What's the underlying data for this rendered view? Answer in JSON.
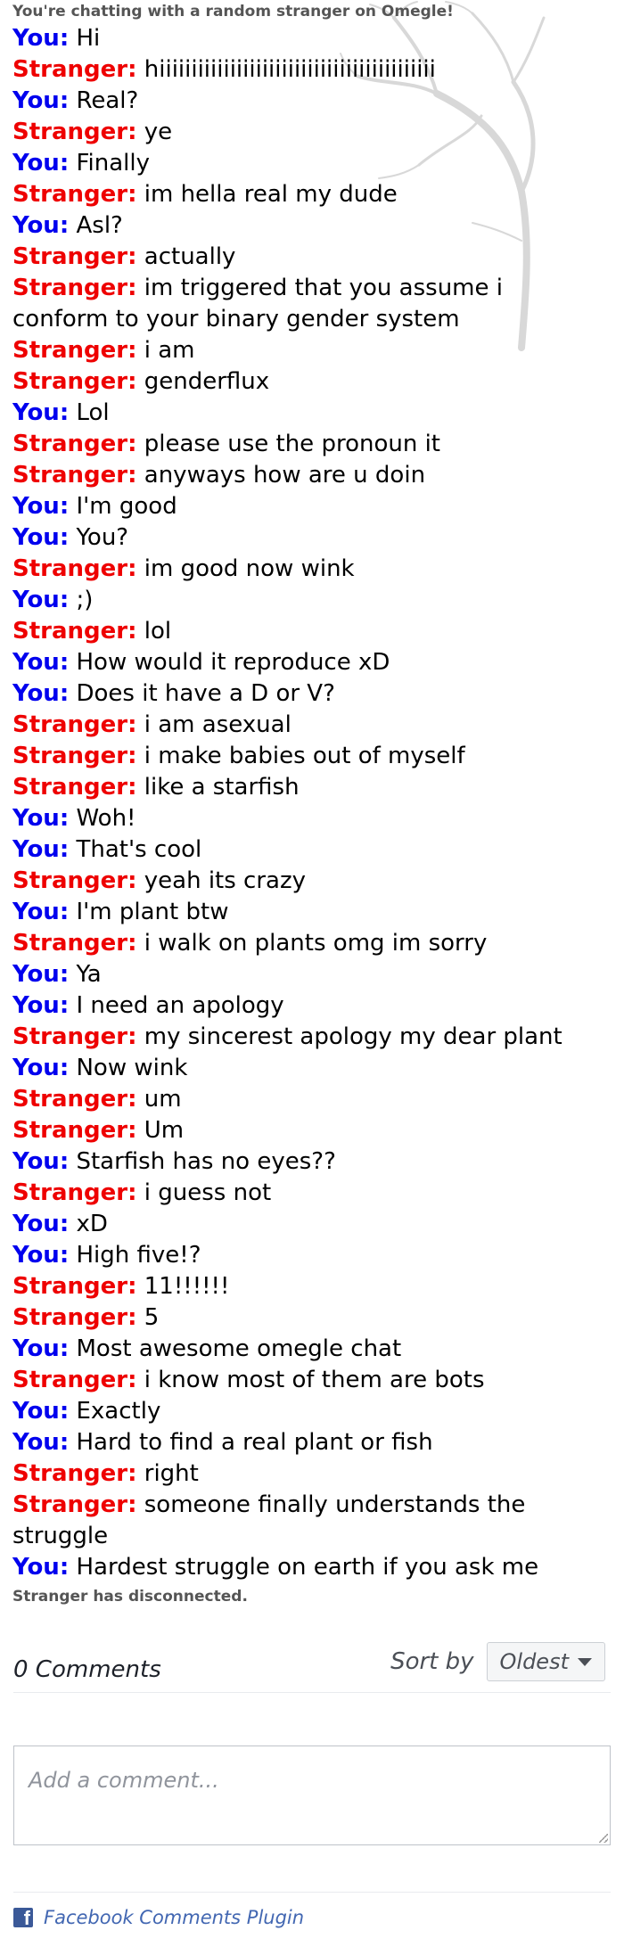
{
  "chat": {
    "header": "You're chatting with a random stranger on Omegle!",
    "messages": [
      {
        "sender": "You:",
        "text": "Hi",
        "role": "you"
      },
      {
        "sender": "Stranger:",
        "text": "hiiiiiiiiiiiiiiiiiiiiiiiiiiiiiiiiiiiiiiiiiii",
        "role": "stranger"
      },
      {
        "sender": "You:",
        "text": "Real?",
        "role": "you"
      },
      {
        "sender": "Stranger:",
        "text": "ye",
        "role": "stranger"
      },
      {
        "sender": "You:",
        "text": "Finally",
        "role": "you"
      },
      {
        "sender": "Stranger:",
        "text": "im hella real my dude",
        "role": "stranger"
      },
      {
        "sender": "You:",
        "text": "Asl?",
        "role": "you"
      },
      {
        "sender": "Stranger:",
        "text": "actually",
        "role": "stranger"
      },
      {
        "sender": "Stranger:",
        "text": "im triggered that you assume i conform to your binary gender system",
        "role": "stranger"
      },
      {
        "sender": "Stranger:",
        "text": "i am",
        "role": "stranger"
      },
      {
        "sender": "Stranger:",
        "text": "genderflux",
        "role": "stranger"
      },
      {
        "sender": "You:",
        "text": "Lol",
        "role": "you"
      },
      {
        "sender": "Stranger:",
        "text": "please use the pronoun it",
        "role": "stranger"
      },
      {
        "sender": "Stranger:",
        "text": "anyways how are u doin",
        "role": "stranger"
      },
      {
        "sender": "You:",
        "text": "I'm good",
        "role": "you"
      },
      {
        "sender": "You:",
        "text": "You?",
        "role": "you"
      },
      {
        "sender": "Stranger:",
        "text": "im good now wink",
        "role": "stranger"
      },
      {
        "sender": "You:",
        "text": ";)",
        "role": "you"
      },
      {
        "sender": "Stranger:",
        "text": "lol",
        "role": "stranger"
      },
      {
        "sender": "You:",
        "text": "How would it reproduce xD",
        "role": "you"
      },
      {
        "sender": "You:",
        "text": "Does it have a D or V?",
        "role": "you"
      },
      {
        "sender": "Stranger:",
        "text": "i am asexual",
        "role": "stranger"
      },
      {
        "sender": "Stranger:",
        "text": "i make babies out of myself",
        "role": "stranger"
      },
      {
        "sender": "Stranger:",
        "text": "like a starfish",
        "role": "stranger"
      },
      {
        "sender": "You:",
        "text": "Woh!",
        "role": "you"
      },
      {
        "sender": "You:",
        "text": "That's cool",
        "role": "you"
      },
      {
        "sender": "Stranger:",
        "text": "yeah its crazy",
        "role": "stranger"
      },
      {
        "sender": "You:",
        "text": "I'm plant btw",
        "role": "you"
      },
      {
        "sender": "Stranger:",
        "text": "i walk on plants omg im sorry",
        "role": "stranger"
      },
      {
        "sender": "You:",
        "text": "Ya",
        "role": "you"
      },
      {
        "sender": "You:",
        "text": "I need an apology",
        "role": "you"
      },
      {
        "sender": "Stranger:",
        "text": "my sincerest apology my dear plant",
        "role": "stranger"
      },
      {
        "sender": "You:",
        "text": "Now wink",
        "role": "you"
      },
      {
        "sender": "Stranger:",
        "text": "um",
        "role": "stranger"
      },
      {
        "sender": "Stranger:",
        "text": "Um",
        "role": "stranger"
      },
      {
        "sender": "You:",
        "text": "Starfish has no eyes??",
        "role": "you"
      },
      {
        "sender": "Stranger:",
        "text": "i guess not",
        "role": "stranger"
      },
      {
        "sender": "You:",
        "text": "xD",
        "role": "you"
      },
      {
        "sender": "You:",
        "text": "High five!?",
        "role": "you"
      },
      {
        "sender": "Stranger:",
        "text": "11!!!!!!",
        "role": "stranger"
      },
      {
        "sender": "Stranger:",
        "text": "5",
        "role": "stranger"
      },
      {
        "sender": "You:",
        "text": "Most awesome omegle chat",
        "role": "you"
      },
      {
        "sender": "Stranger:",
        "text": "i know most of them are bots",
        "role": "stranger"
      },
      {
        "sender": "You:",
        "text": "Exactly",
        "role": "you"
      },
      {
        "sender": "You:",
        "text": "Hard to find a real plant or fish",
        "role": "you"
      },
      {
        "sender": "Stranger:",
        "text": "right",
        "role": "stranger"
      },
      {
        "sender": "Stranger:",
        "text": "someone finally understands the struggle",
        "role": "stranger"
      },
      {
        "sender": "You:",
        "text": "Hardest struggle on earth if you ask me",
        "role": "you"
      }
    ],
    "footer": "Stranger has disconnected."
  },
  "comments": {
    "count_label": "0 Comments",
    "sort_label": "Sort by",
    "sort_value": "Oldest",
    "input_placeholder": "Add a comment...",
    "plugin_label": "Facebook Comments Plugin"
  },
  "colors": {
    "you": "#0000ee",
    "stranger": "#ee0000",
    "status": "#555555",
    "facebook": "#3b5998"
  },
  "icons": {
    "sort": "chevron-down-icon",
    "plugin": "facebook-icon",
    "background": "tree-icon"
  }
}
